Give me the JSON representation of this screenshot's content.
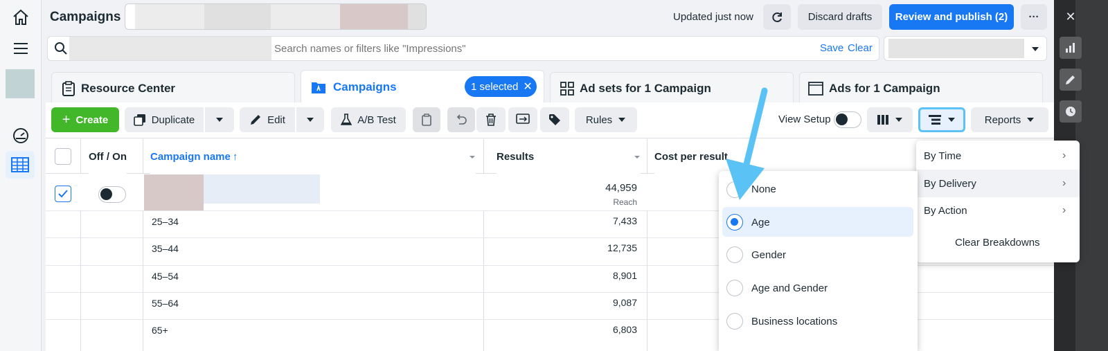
{
  "header": {
    "title": "Campaigns",
    "updated": "Updated just now",
    "discard": "Discard drafts",
    "publish": "Review and publish (2)",
    "more": "···"
  },
  "search": {
    "placeholder": "Search names or filters like \"Impressions\"",
    "save": "Save",
    "clear": "Clear"
  },
  "tabs": [
    {
      "label": "Resource Center"
    },
    {
      "label": "Campaigns",
      "badge": "1 selected"
    },
    {
      "label": "Ad sets for 1 Campaign"
    },
    {
      "label": "Ads for 1 Campaign"
    }
  ],
  "toolbar": {
    "create": "Create",
    "duplicate": "Duplicate",
    "edit": "Edit",
    "abtest": "A/B Test",
    "rules": "Rules",
    "view_setup": "View Setup",
    "reports": "Reports"
  },
  "table": {
    "headers": {
      "onoff": "Off / On",
      "name": "Campaign name",
      "results": "Results",
      "cost": "Cost per result"
    },
    "summary": {
      "results": "44,959",
      "results_sub": "Reach"
    },
    "rows": [
      {
        "name": "25–34",
        "results": "7,433"
      },
      {
        "name": "35–44",
        "results": "12,735"
      },
      {
        "name": "45–54",
        "results": "8,901"
      },
      {
        "name": "55–64",
        "results": "9,087"
      },
      {
        "name": "65+",
        "results": "6,803"
      }
    ]
  },
  "breakdown_menu": {
    "items": [
      {
        "label": "By Time"
      },
      {
        "label": "By Delivery"
      },
      {
        "label": "By Action"
      }
    ],
    "clear": "Clear Breakdowns"
  },
  "delivery_menu": {
    "options": [
      {
        "label": "None",
        "selected": false
      },
      {
        "label": "Age",
        "selected": true
      },
      {
        "label": "Gender",
        "selected": false
      },
      {
        "label": "Age and Gender",
        "selected": false
      },
      {
        "label": "Business locations",
        "selected": false
      }
    ]
  },
  "colors": {
    "accent": "#1877f2",
    "create": "#42b72a",
    "arrow": "#5bc2f5"
  }
}
